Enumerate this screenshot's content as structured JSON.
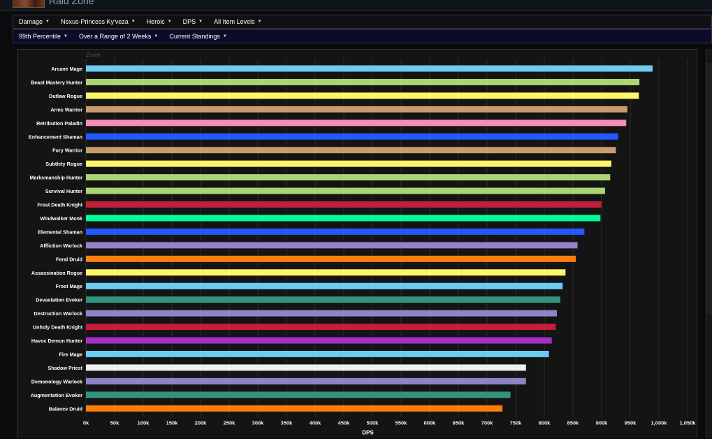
{
  "header": {
    "title": "Raid Zone"
  },
  "filters_primary": [
    {
      "label": "Damage"
    },
    {
      "label": "Nexus-Princess Ky'veza"
    },
    {
      "label": "Heroic"
    },
    {
      "label": "DPS"
    },
    {
      "label": "All Item Levels"
    }
  ],
  "filters_secondary": [
    {
      "label": "99th Percentile"
    },
    {
      "label": "Over a Range of 2 Weeks"
    },
    {
      "label": "Current Standings"
    }
  ],
  "chart": {
    "zoom_label": "Zoom"
  },
  "colors": {
    "background": "#141414",
    "grid": "#2c2c2c",
    "mage": "#69ccf0",
    "hunter": "#abd473",
    "rogue": "#fff569",
    "warrior": "#c79c6e",
    "paladin": "#f58cba",
    "shaman": "#2459ff",
    "death_knight": "#c41e3a",
    "monk": "#00ff98",
    "warlock": "#9482c9",
    "druid": "#ff7d0a",
    "evoker": "#33937f",
    "demon_hunter": "#a330c9",
    "priest": "#f0f0f0"
  },
  "chart_data": {
    "type": "bar",
    "orientation": "horizontal",
    "title": "",
    "xlabel": "DPS",
    "ylabel": "",
    "xlim": [
      0,
      1050000
    ],
    "x_ticks": [
      {
        "value": 0,
        "label": "0k"
      },
      {
        "value": 50000,
        "label": "50k"
      },
      {
        "value": 100000,
        "label": "100k"
      },
      {
        "value": 150000,
        "label": "150k"
      },
      {
        "value": 200000,
        "label": "200k"
      },
      {
        "value": 250000,
        "label": "250k"
      },
      {
        "value": 300000,
        "label": "300k"
      },
      {
        "value": 350000,
        "label": "350k"
      },
      {
        "value": 400000,
        "label": "400k"
      },
      {
        "value": 450000,
        "label": "450k"
      },
      {
        "value": 500000,
        "label": "500k"
      },
      {
        "value": 550000,
        "label": "550k"
      },
      {
        "value": 600000,
        "label": "600k"
      },
      {
        "value": 650000,
        "label": "650k"
      },
      {
        "value": 700000,
        "label": "700k"
      },
      {
        "value": 750000,
        "label": "750k"
      },
      {
        "value": 800000,
        "label": "800k"
      },
      {
        "value": 850000,
        "label": "850k"
      },
      {
        "value": 900000,
        "label": "900k"
      },
      {
        "value": 950000,
        "label": "950k"
      },
      {
        "value": 1000000,
        "label": "1,000k"
      },
      {
        "value": 1050000,
        "label": "1,050k"
      }
    ],
    "grid": true,
    "legend": "none",
    "bars": [
      {
        "name": "Arcane Mage",
        "value": 989000,
        "color": "#69ccf0"
      },
      {
        "name": "Beast Mastery Hunter",
        "value": 966000,
        "color": "#abd473"
      },
      {
        "name": "Outlaw Rogue",
        "value": 965000,
        "color": "#fff569"
      },
      {
        "name": "Arms Warrior",
        "value": 945000,
        "color": "#c79c6e"
      },
      {
        "name": "Retribution Paladin",
        "value": 943000,
        "color": "#f58cba"
      },
      {
        "name": "Enhancement Shaman",
        "value": 929000,
        "color": "#2459ff"
      },
      {
        "name": "Fury Warrior",
        "value": 925000,
        "color": "#c79c6e"
      },
      {
        "name": "Subtlety Rogue",
        "value": 917000,
        "color": "#fff569"
      },
      {
        "name": "Marksmanship Hunter",
        "value": 915000,
        "color": "#abd473"
      },
      {
        "name": "Survival Hunter",
        "value": 906000,
        "color": "#abd473"
      },
      {
        "name": "Frost Death Knight",
        "value": 900000,
        "color": "#c41e3a"
      },
      {
        "name": "Windwalker Monk",
        "value": 898000,
        "color": "#00ff98"
      },
      {
        "name": "Elemental Shaman",
        "value": 870000,
        "color": "#2459ff"
      },
      {
        "name": "Affliction Warlock",
        "value": 858000,
        "color": "#9482c9"
      },
      {
        "name": "Feral Druid",
        "value": 855000,
        "color": "#ff7d0a"
      },
      {
        "name": "Assassination Rogue",
        "value": 837000,
        "color": "#fff569"
      },
      {
        "name": "Frost Mage",
        "value": 832000,
        "color": "#69ccf0"
      },
      {
        "name": "Devastation Evoker",
        "value": 828000,
        "color": "#33937f"
      },
      {
        "name": "Destruction Warlock",
        "value": 822000,
        "color": "#9482c9"
      },
      {
        "name": "Unholy Death Knight",
        "value": 820000,
        "color": "#c41e3a"
      },
      {
        "name": "Havoc Demon Hunter",
        "value": 813000,
        "color": "#a330c9"
      },
      {
        "name": "Fire Mage",
        "value": 808000,
        "color": "#69ccf0"
      },
      {
        "name": "Shadow Priest",
        "value": 768000,
        "color": "#f0f0f0"
      },
      {
        "name": "Demonology Warlock",
        "value": 768000,
        "color": "#9482c9"
      },
      {
        "name": "Augmentation Evoker",
        "value": 741000,
        "color": "#33937f"
      },
      {
        "name": "Balance Druid",
        "value": 727000,
        "color": "#ff7d0a"
      }
    ]
  }
}
